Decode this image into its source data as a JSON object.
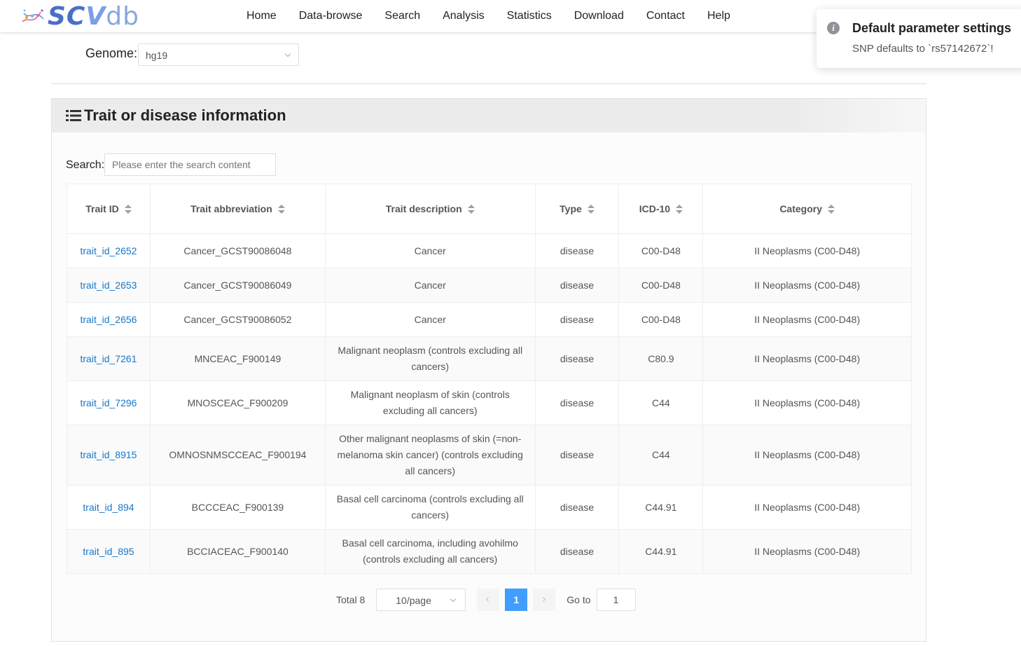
{
  "brand": {
    "logo_text_1": "SC",
    "logo_text_2": "V",
    "logo_text_3": "db"
  },
  "nav": [
    "Home",
    "Data-browse",
    "Search",
    "Analysis",
    "Statistics",
    "Download",
    "Contact",
    "Help"
  ],
  "genome": {
    "label": "Genome:",
    "value": "hg19"
  },
  "panel": {
    "title": "Trait or disease information"
  },
  "search": {
    "label": "Search:",
    "placeholder": "Please enter the search content"
  },
  "table": {
    "headers": [
      "Trait ID",
      "Trait abbreviation",
      "Trait description",
      "Type",
      "ICD-10",
      "Category"
    ],
    "rows": [
      [
        "trait_id_2652",
        "Cancer_GCST90086048",
        "Cancer",
        "disease",
        "C00-D48",
        "II Neoplasms (C00-D48)"
      ],
      [
        "trait_id_2653",
        "Cancer_GCST90086049",
        "Cancer",
        "disease",
        "C00-D48",
        "II Neoplasms (C00-D48)"
      ],
      [
        "trait_id_2656",
        "Cancer_GCST90086052",
        "Cancer",
        "disease",
        "C00-D48",
        "II Neoplasms (C00-D48)"
      ],
      [
        "trait_id_7261",
        "MNCEAC_F900149",
        "Malignant neoplasm (controls excluding all cancers)",
        "disease",
        "C80.9",
        "II Neoplasms (C00-D48)"
      ],
      [
        "trait_id_7296",
        "MNOSCEAC_F900209",
        "Malignant neoplasm of skin (controls excluding all cancers)",
        "disease",
        "C44",
        "II Neoplasms (C00-D48)"
      ],
      [
        "trait_id_8915",
        "OMNOSNMSCCEAC_F900194",
        "Other malignant neoplasms of skin (=non-melanoma skin cancer) (controls excluding all cancers)",
        "disease",
        "C44",
        "II Neoplasms (C00-D48)"
      ],
      [
        "trait_id_894",
        "BCCCEAC_F900139",
        "Basal cell carcinoma (controls excluding all cancers)",
        "disease",
        "C44.91",
        "II Neoplasms (C00-D48)"
      ],
      [
        "trait_id_895",
        "BCCIACEAC_F900140",
        "Basal cell carcinoma, including avohilmo (controls excluding all cancers)",
        "disease",
        "C44.91",
        "II Neoplasms (C00-D48)"
      ]
    ]
  },
  "pagination": {
    "total": "Total 8",
    "page_size": "10/page",
    "current_page": "1",
    "goto_label": "Go to",
    "goto_value": "1"
  },
  "toast": {
    "title": "Default parameter settings",
    "message": "SNP defaults to `rs57142672`!"
  },
  "colors": {
    "link": "#1677c8",
    "accent": "#409eff",
    "logo_primary": "#4a6fc9"
  }
}
